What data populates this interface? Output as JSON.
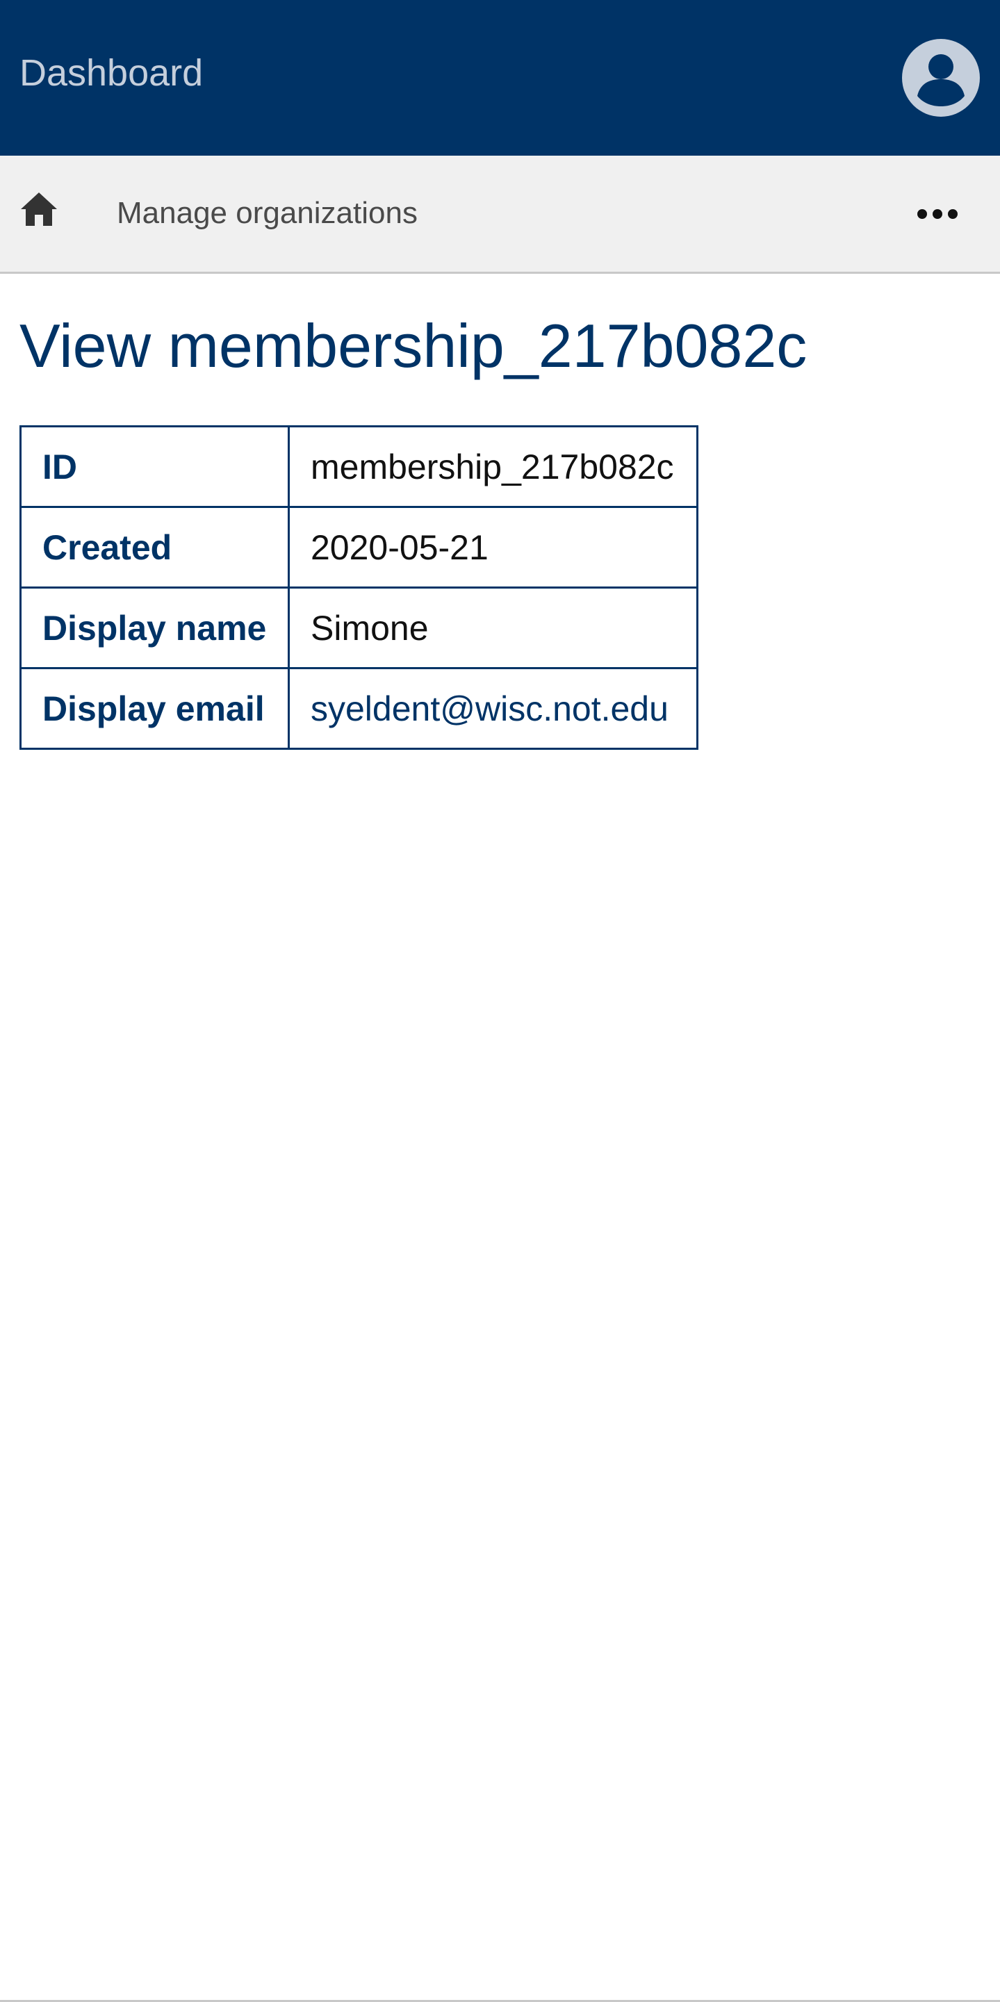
{
  "header": {
    "brand": "Dashboard",
    "icons": {
      "account": "user-circle-icon"
    },
    "colors": {
      "background": "#003366",
      "brand_text": "#c5cfdc",
      "avatar": "#c5cfdc"
    }
  },
  "nav": {
    "icons": {
      "home": "home-icon",
      "more": "more-horizontal-icon"
    },
    "link_label": "Manage organizations"
  },
  "page": {
    "title": "View membership_217b082c"
  },
  "details": {
    "rows": [
      {
        "label": "ID",
        "value": "membership_217b082c"
      },
      {
        "label": "Created",
        "value": "2020-05-21"
      },
      {
        "label": "Display name",
        "value": "Simone"
      },
      {
        "label": "Display email",
        "value": "syeldent@wisc.not.edu"
      }
    ]
  }
}
